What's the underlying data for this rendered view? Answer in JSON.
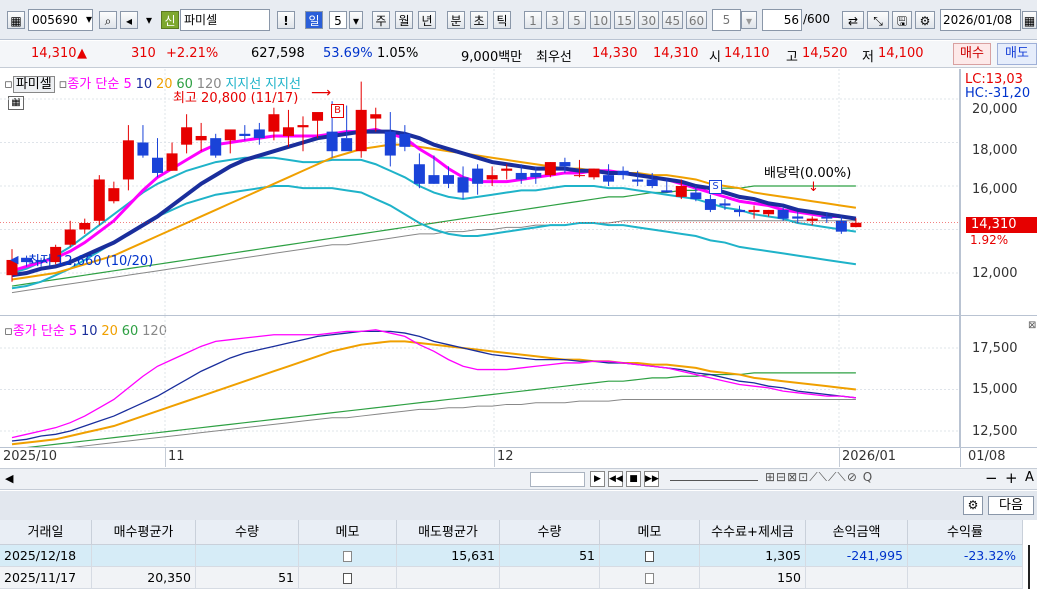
{
  "toolbar": {
    "code": "005690",
    "new_badge": "신",
    "name": "파미셀",
    "bang": "!",
    "periods": [
      "일",
      "5",
      "주",
      "월",
      "년",
      "분",
      "초",
      "틱"
    ],
    "active_period": "일",
    "nums": [
      "1",
      "3",
      "5",
      "10",
      "15",
      "30",
      "45",
      "60",
      "5"
    ],
    "count": "56",
    "count_total": "/600",
    "date": "2026/01/08"
  },
  "quote": {
    "price": "14,310",
    "arrow": "▲",
    "change": "310",
    "pct": "+2.21%",
    "volume": "627,598",
    "vol_ratio": "53.69%",
    "turnover": "1.05%",
    "amount": "9,000백만",
    "best_label": "최우선",
    "best_ask": "14,330",
    "best_bid": "14,310",
    "open_label": "시",
    "open": "14,110",
    "high_label": "고",
    "high": "14,520",
    "low_label": "저",
    "low": "14,100",
    "buy_btn": "매수",
    "sell_btn": "매도"
  },
  "legend1": {
    "name": "파미셀",
    "ma_label": "종가 단순 5",
    "p10": "10",
    "p20": "20",
    "p60": "60",
    "p120": "120",
    "support1": "지지선",
    "support2": "지지선"
  },
  "legend2": {
    "ma_label": "종가 단순 5",
    "p10": "10",
    "p20": "20",
    "p60": "60",
    "p120": "120"
  },
  "annotations": {
    "high": "최고 20,800 (11/17)",
    "low": "최저 12,660 (10/20)",
    "dividend": "배당락(0.00%)",
    "buy": "B",
    "sell": "S"
  },
  "axis": {
    "lc": "LC:13,03",
    "hc": "HC:-31,20",
    "ticks": [
      "20,000",
      "18,000",
      "16,000",
      "14,000",
      "12,000"
    ],
    "last_price": "14,310",
    "last_pct": "1.92%",
    "ticks2": [
      "17,500",
      "15,000",
      "12,500"
    ]
  },
  "xaxis": {
    "labels": [
      "2025/10",
      "11",
      "12",
      "2026/01",
      "01/08"
    ]
  },
  "table": {
    "next_btn": "다음",
    "headers": [
      "거래일",
      "매수평균가",
      "수량",
      "메모",
      "매도평균가",
      "수량",
      "메모",
      "수수료+제세금",
      "손익금액",
      "수익률"
    ],
    "rows": [
      [
        "2025/12/18",
        "",
        "",
        "",
        "15,631",
        "51",
        "",
        "1,305",
        "-241,995",
        "-23.32%"
      ],
      [
        "2025/11/17",
        "20,350",
        "51",
        "",
        "",
        "",
        "",
        "150",
        "",
        ""
      ]
    ]
  },
  "colors": {
    "up": "#e60000",
    "down": "#1a43d8",
    "ma5": "#ff00ff",
    "ma10": "#1a2e9c",
    "ma20": "#f0a000",
    "ma60": "#2ea043",
    "ma120": "#888888",
    "support": "#1fb3c9"
  },
  "chart_data": {
    "type": "candlestick",
    "ylim": [
      11600,
      20800
    ],
    "candles": [
      [
        11900,
        13100,
        11600,
        12600
      ],
      [
        12700,
        12800,
        12300,
        12500
      ],
      [
        12600,
        12700,
        12300,
        12500
      ],
      [
        12500,
        13300,
        12400,
        13200
      ],
      [
        13300,
        14400,
        13200,
        14000
      ],
      [
        14000,
        14500,
        13800,
        14300
      ],
      [
        14400,
        16500,
        14200,
        16300
      ],
      [
        15300,
        16200,
        15200,
        15900
      ],
      [
        16300,
        18800,
        15800,
        18100
      ],
      [
        18000,
        18800,
        17300,
        17400
      ],
      [
        17300,
        18200,
        16400,
        16600
      ],
      [
        16700,
        18000,
        16700,
        17500
      ],
      [
        17900,
        19300,
        17500,
        18700
      ],
      [
        18100,
        18900,
        17600,
        18300
      ],
      [
        18200,
        18400,
        17300,
        17400
      ],
      [
        18100,
        18400,
        17500,
        18600
      ],
      [
        18400,
        18800,
        18100,
        18300
      ],
      [
        18600,
        18900,
        17900,
        18200
      ],
      [
        18500,
        19600,
        18100,
        19300
      ],
      [
        18300,
        19500,
        17800,
        18700
      ],
      [
        18700,
        19200,
        17600,
        18800
      ],
      [
        19000,
        19300,
        18200,
        19400
      ],
      [
        18500,
        19900,
        17300,
        17600
      ],
      [
        18200,
        19700,
        18200,
        17600
      ],
      [
        17600,
        20800,
        17300,
        19500
      ],
      [
        19100,
        19600,
        18500,
        19300
      ],
      [
        18500,
        19400,
        16900,
        17400
      ],
      [
        18400,
        18800,
        17600,
        17800
      ],
      [
        17000,
        17500,
        15900,
        16100
      ],
      [
        16500,
        17400,
        16100,
        16100
      ],
      [
        16500,
        16900,
        15900,
        16100
      ],
      [
        16400,
        16900,
        15400,
        15700
      ],
      [
        16800,
        17000,
        15600,
        16100
      ],
      [
        16300,
        16900,
        16000,
        16500
      ],
      [
        16700,
        17000,
        16300,
        16800
      ],
      [
        16600,
        17000,
        16100,
        16300
      ],
      [
        16600,
        16900,
        16100,
        16400
      ],
      [
        16500,
        17100,
        16400,
        17100
      ],
      [
        17100,
        17300,
        16600,
        16900
      ],
      [
        16500,
        17200,
        16400,
        16500
      ],
      [
        16400,
        16800,
        16300,
        16800
      ],
      [
        16500,
        17000,
        16000,
        16200
      ],
      [
        16700,
        16900,
        16300,
        16500
      ],
      [
        16300,
        16700,
        16000,
        16200
      ],
      [
        16300,
        16600,
        15900,
        16000
      ],
      [
        15800,
        16300,
        15700,
        15700
      ],
      [
        15500,
        16300,
        15400,
        16000
      ],
      [
        15700,
        16000,
        15300,
        15400
      ],
      [
        15400,
        15600,
        14800,
        14900
      ],
      [
        15200,
        15400,
        14900,
        15100
      ],
      [
        14900,
        15100,
        14600,
        14800
      ],
      [
        14800,
        15100,
        14500,
        14900
      ],
      [
        14700,
        14900,
        14600,
        14900
      ],
      [
        14900,
        15000,
        14400,
        14500
      ],
      [
        14600,
        14800,
        14300,
        14500
      ],
      [
        14400,
        14600,
        14200,
        14500
      ],
      [
        14600,
        14800,
        14300,
        14500
      ],
      [
        14400,
        14600,
        13800,
        13900
      ],
      [
        14110,
        14520,
        14100,
        14310
      ]
    ],
    "ma": {
      "ma5": [
        12100,
        12300,
        12500,
        12700,
        13000,
        13400,
        13900,
        14400,
        15100,
        15800,
        16400,
        16800,
        17200,
        17600,
        17900,
        18000,
        18100,
        18200,
        18300,
        18300,
        18300,
        18300,
        18400,
        18500,
        18500,
        18600,
        18400,
        18200,
        17700,
        17300,
        16800,
        16400,
        16200,
        16200,
        16200,
        16300,
        16400,
        16500,
        16600,
        16600,
        16700,
        16700,
        16600,
        16500,
        16400,
        16300,
        16100,
        15900,
        15700,
        15500,
        15300,
        15200,
        15100,
        14900,
        14800,
        14700,
        14600,
        14600,
        14500
      ],
      "ma10": [
        11900,
        12000,
        12200,
        12300,
        12500,
        12800,
        13100,
        13400,
        13800,
        14200,
        14600,
        15100,
        15600,
        16100,
        16500,
        16900,
        17200,
        17400,
        17600,
        17800,
        18000,
        18200,
        18300,
        18400,
        18500,
        18500,
        18500,
        18400,
        18200,
        17900,
        17700,
        17500,
        17300,
        17100,
        17000,
        16900,
        16800,
        16800,
        16800,
        16700,
        16700,
        16600,
        16600,
        16500,
        16400,
        16300,
        16200,
        16000,
        15900,
        15700,
        15500,
        15400,
        15200,
        15100,
        14900,
        14800,
        14700,
        14600,
        14500
      ],
      "ma20": [
        11700,
        11800,
        11900,
        12000,
        12200,
        12400,
        12600,
        12800,
        13100,
        13400,
        13700,
        14000,
        14300,
        14600,
        14900,
        15200,
        15500,
        15800,
        16100,
        16400,
        16700,
        17000,
        17300,
        17500,
        17700,
        17800,
        17900,
        17900,
        17800,
        17700,
        17600,
        17500,
        17400,
        17300,
        17200,
        17100,
        17000,
        16900,
        16800,
        16800,
        16700,
        16700,
        16600,
        16600,
        16500,
        16500,
        16400,
        16300,
        16100,
        16000,
        15900,
        15700,
        15600,
        15500,
        15400,
        15300,
        15200,
        15100,
        15000
      ],
      "ma60": [
        11400,
        11500,
        11600,
        11700,
        11800,
        11900,
        12000,
        12100,
        12200,
        12300,
        12400,
        12500,
        12600,
        12700,
        12800,
        12900,
        13000,
        13100,
        13200,
        13300,
        13400,
        13500,
        13600,
        13700,
        13800,
        13900,
        14000,
        14100,
        14200,
        14300,
        14400,
        14500,
        14600,
        14700,
        14800,
        14900,
        15000,
        15100,
        15200,
        15300,
        15400,
        15500,
        15500,
        15600,
        15700,
        15700,
        15800,
        15800,
        15900,
        15900,
        15900,
        16000,
        16000,
        16000,
        16000,
        16000,
        16000,
        16000,
        16000
      ],
      "ma120": [
        11100,
        11200,
        11300,
        11400,
        11500,
        11600,
        11700,
        11800,
        11900,
        12000,
        12100,
        12200,
        12300,
        12400,
        12500,
        12600,
        12700,
        12800,
        12900,
        13000,
        13100,
        13200,
        13300,
        13300,
        13400,
        13500,
        13600,
        13700,
        13800,
        13800,
        13900,
        13900,
        14000,
        14000,
        14100,
        14100,
        14200,
        14200,
        14200,
        14300,
        14300,
        14300,
        14400,
        14400,
        14400,
        14400,
        14400,
        14400,
        14400,
        14400,
        14400,
        14400,
        14400,
        14400,
        14400,
        14400,
        14400,
        14400,
        14400
      ],
      "support_upper": [
        12000,
        12200,
        12500,
        12800,
        13200,
        13700,
        14200,
        14700,
        15200,
        15700,
        16100,
        16400,
        16700,
        16900,
        17100,
        17200,
        17300,
        17300,
        17300,
        17200,
        17100,
        17100,
        17200,
        17200,
        17200,
        17000,
        16700,
        16400,
        16000,
        15700,
        15500,
        15400,
        15500,
        15600,
        15700,
        15800,
        15800,
        15900,
        16000,
        16000,
        16000,
        15900,
        15900,
        15800,
        15700,
        15600,
        15500,
        15400,
        15200,
        15000,
        14900,
        14700,
        14600,
        14500,
        14300,
        14200,
        14100,
        14000,
        13900
      ],
      "support_lower": [
        11300,
        11400,
        11600,
        11900,
        12200,
        12600,
        13000,
        13400,
        13800,
        14200,
        14600,
        14900,
        15200,
        15400,
        15600,
        15700,
        15800,
        15900,
        16000,
        16000,
        15900,
        15900,
        15900,
        15800,
        15700,
        15400,
        15100,
        14700,
        14300,
        14000,
        13800,
        13700,
        13700,
        13800,
        13900,
        14000,
        14100,
        14200,
        14200,
        14300,
        14300,
        14200,
        14200,
        14100,
        14000,
        13900,
        13800,
        13700,
        13500,
        13400,
        13200,
        13100,
        13000,
        12900,
        12800,
        12700,
        12600,
        12500,
        12400
      ]
    }
  }
}
